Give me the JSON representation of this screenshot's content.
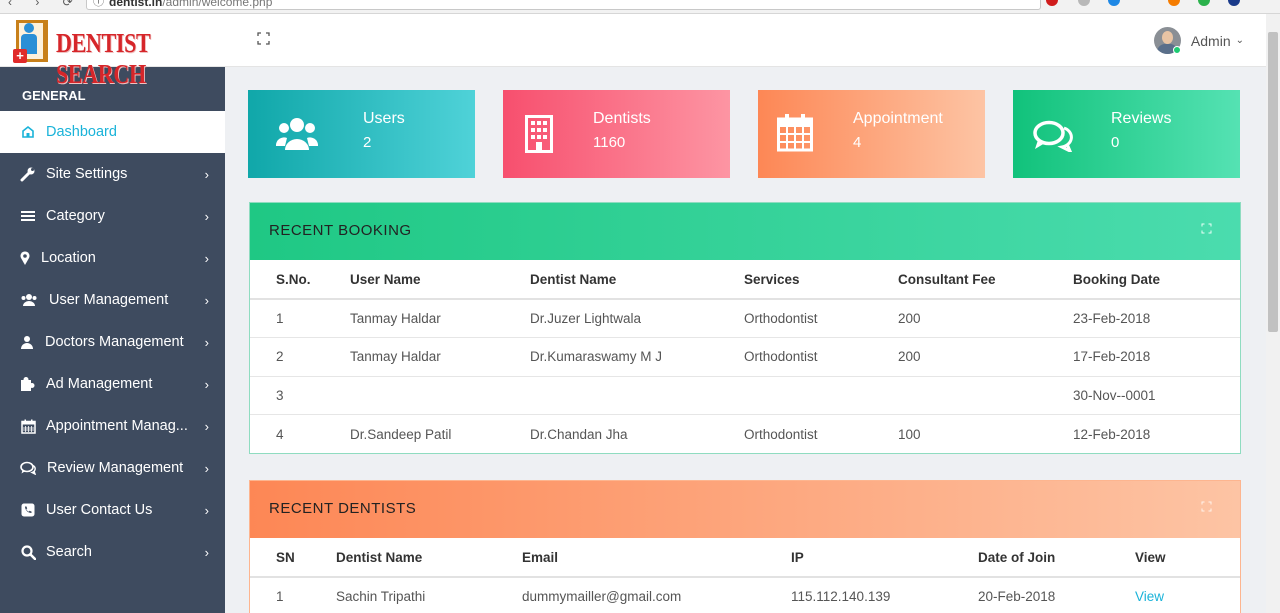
{
  "browser": {
    "url_host": "dentist.in",
    "url_path": "/admin/welcome.php"
  },
  "brand": {
    "name": "DENTIST SEARCH"
  },
  "sidebar": {
    "section": "GENERAL",
    "items": [
      {
        "label": "Dashboard",
        "icon": "home-icon"
      },
      {
        "label": "Site Settings",
        "icon": "wrench-icon"
      },
      {
        "label": "Category",
        "icon": "list-icon"
      },
      {
        "label": "Location",
        "icon": "map-marker-icon"
      },
      {
        "label": "User Management",
        "icon": "users-icon"
      },
      {
        "label": "Doctors Management",
        "icon": "user-doctor-icon"
      },
      {
        "label": "Ad Management",
        "icon": "puzzle-icon"
      },
      {
        "label": "Appointment Manag...",
        "icon": "calendar-icon"
      },
      {
        "label": "Review Management",
        "icon": "comments-icon"
      },
      {
        "label": "User Contact Us",
        "icon": "phone-icon"
      },
      {
        "label": "Search",
        "icon": "search-icon"
      }
    ]
  },
  "header": {
    "user": "Admin"
  },
  "stats": [
    {
      "label": "Users",
      "value": "2",
      "icon": "users-icon",
      "colors": [
        "#10a7a9",
        "#4fd2d8"
      ]
    },
    {
      "label": "Dentists",
      "value": "1160",
      "icon": "building-icon",
      "colors": [
        "#f74f6e",
        "#fd95a3"
      ]
    },
    {
      "label": "Appointment",
      "value": "4",
      "icon": "calendar-icon",
      "colors": [
        "#fd8755",
        "#fdc4a4"
      ]
    },
    {
      "label": "Reviews",
      "value": "0",
      "icon": "comments-icon",
      "colors": [
        "#11c27b",
        "#55e2b3"
      ]
    }
  ],
  "recent_booking": {
    "title": "RECENT BOOKING",
    "columns": [
      "S.No.",
      "User Name",
      "Dentist Name",
      "Services",
      "Consultant Fee",
      "Booking Date"
    ],
    "rows": [
      [
        "1",
        "Tanmay Haldar",
        "Dr.Juzer Lightwala",
        "Orthodontist",
        "200",
        "23-Feb-2018"
      ],
      [
        "2",
        "Tanmay Haldar",
        "Dr.Kumaraswamy M J",
        "Orthodontist",
        "200",
        "17-Feb-2018"
      ],
      [
        "3",
        "",
        "",
        "",
        "",
        "30-Nov--0001"
      ],
      [
        "4",
        "Dr.Sandeep Patil",
        "Dr.Chandan Jha",
        "Orthodontist",
        "100",
        "12-Feb-2018"
      ]
    ]
  },
  "recent_dentists": {
    "title": "RECENT DENTISTS",
    "columns": [
      "SN",
      "Dentist Name",
      "Email",
      "IP",
      "Date of Join",
      "View"
    ],
    "rows": [
      [
        "1",
        "Sachin Tripathi",
        "dummymailler@gmail.com",
        "115.112.140.139",
        "20-Feb-2018",
        "View"
      ]
    ]
  },
  "colors": {
    "sidebar_bg": "#3e4b5f",
    "accent": "#1ab3d9",
    "booking_head": [
      "#1fc884",
      "#4bdcae"
    ],
    "dentists_head": [
      "#fd8755",
      "#fdc4a4"
    ]
  }
}
